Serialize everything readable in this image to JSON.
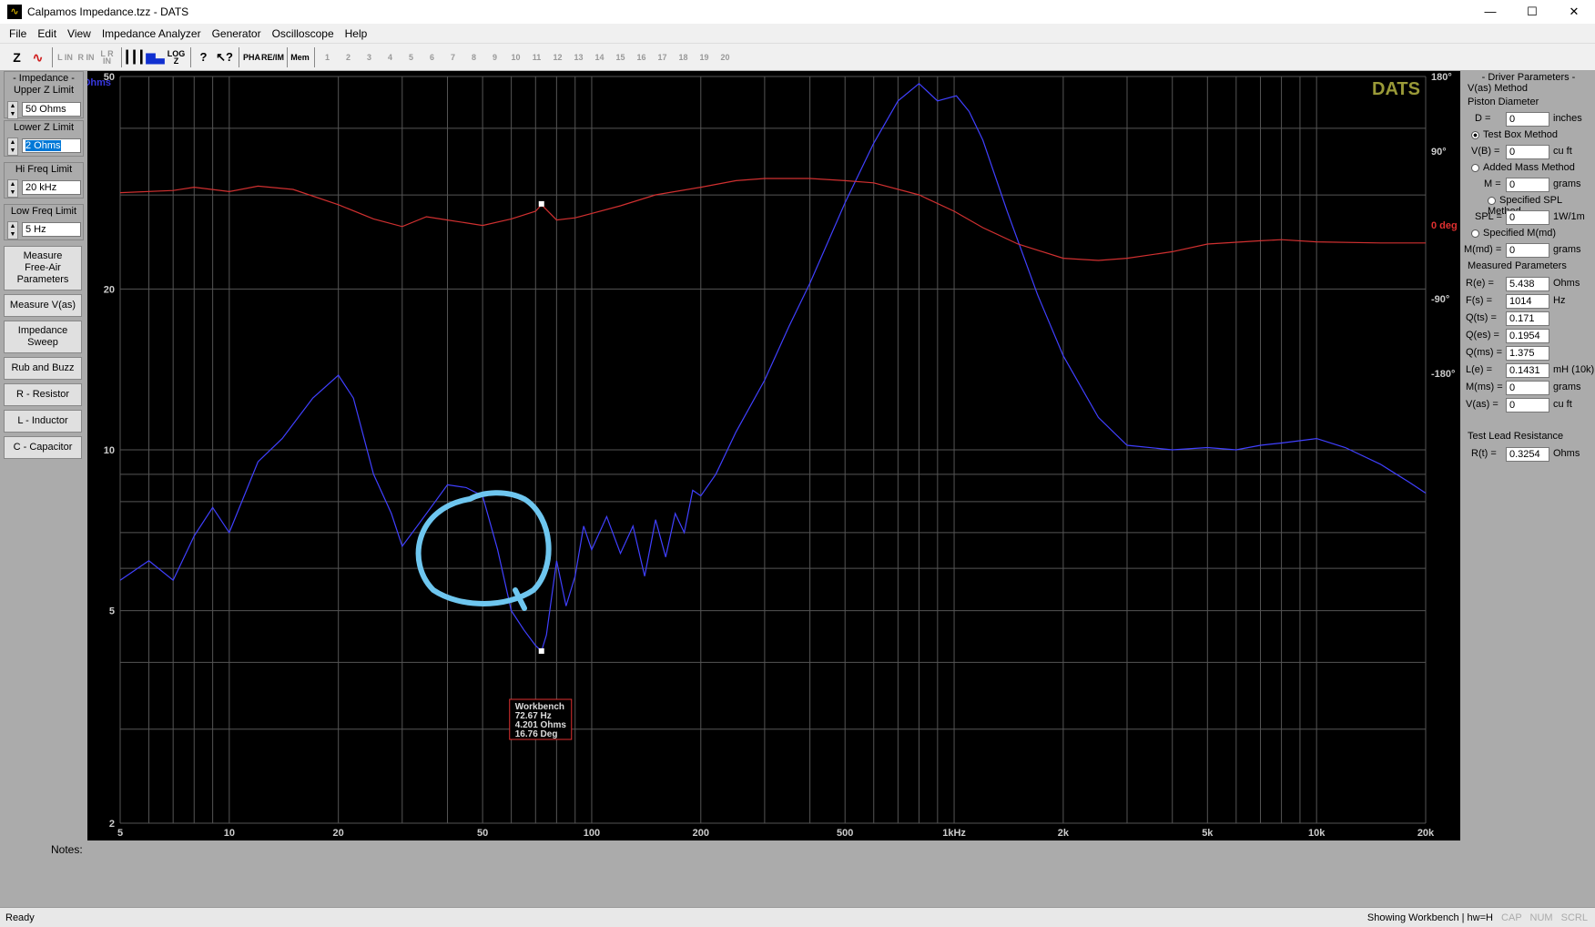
{
  "window": {
    "title": "Calpamos Impedance.tzz - DATS",
    "minimize": "—",
    "maximize": "☐",
    "close": "✕"
  },
  "menu": [
    "File",
    "Edit",
    "View",
    "Impedance Analyzer",
    "Generator",
    "Oscilloscope",
    "Help"
  ],
  "toolbar": {
    "z_label": "Z",
    "pha_label": "PHA",
    "reim_label": "RE/IM",
    "mem_label": "Mem",
    "mem_slots": [
      "1",
      "2",
      "3",
      "4",
      "5",
      "6",
      "7",
      "8",
      "9",
      "10",
      "11",
      "12",
      "13",
      "14",
      "15",
      "16",
      "17",
      "18",
      "19",
      "20"
    ]
  },
  "left_panel": {
    "title": "- Impedance -",
    "upper_z": {
      "label": "Upper Z Limit",
      "value": "50 Ohms"
    },
    "lower_z": {
      "label": "Lower Z Limit",
      "value": "2 Ohms"
    },
    "hi_freq": {
      "label": "Hi Freq Limit",
      "value": "20 kHz"
    },
    "low_freq": {
      "label": "Low Freq Limit",
      "value": "5 Hz"
    },
    "buttons": [
      "Measure Free-Air Parameters",
      "Measure V(as)",
      "Impedance Sweep",
      "Rub and Buzz",
      "R - Resistor",
      "L - Inductor",
      "C - Capacitor"
    ]
  },
  "chart_data": {
    "type": "line",
    "watermark": "DATS",
    "xlabel_ticks": [
      "5",
      "10",
      "20",
      "50",
      "100",
      "200",
      "500",
      "1kHz",
      "2k",
      "5k",
      "10k",
      "20k"
    ],
    "x_ticks_values": [
      5,
      10,
      20,
      50,
      100,
      200,
      500,
      1000,
      2000,
      5000,
      10000,
      20000
    ],
    "xlim": [
      5,
      20000
    ],
    "x_scale": "log",
    "y_left_label": "Ohms",
    "y_left_ticks": [
      "50",
      "20",
      "10",
      "5",
      "2"
    ],
    "y_left_values": [
      50,
      20,
      10,
      5,
      2
    ],
    "ylim_left": [
      2,
      50
    ],
    "y_left_scale": "log",
    "y_right_ticks": [
      "180°",
      "90°",
      "0 deg",
      "-90°",
      "-180°"
    ],
    "y_right_values": [
      180,
      90,
      0,
      -90,
      -180
    ],
    "ylim_right": [
      -180,
      180
    ],
    "series": [
      {
        "name": "Ohms",
        "color": "#4040ff",
        "x": [
          5,
          6,
          7,
          8,
          9,
          10,
          12,
          14,
          17,
          20,
          22,
          25,
          28,
          30,
          33,
          36,
          40,
          45,
          50,
          55,
          60,
          65,
          70,
          72.67,
          75,
          80,
          85,
          90,
          95,
          100,
          110,
          120,
          130,
          140,
          150,
          160,
          170,
          180,
          190,
          200,
          220,
          250,
          300,
          350,
          400,
          500,
          600,
          700,
          800,
          900,
          1014,
          1100,
          1200,
          1400,
          1700,
          2000,
          2500,
          3000,
          4000,
          5000,
          6000,
          7000,
          8000,
          10000,
          12000,
          15000,
          18000,
          20000
        ],
        "y": [
          5.7,
          6.2,
          5.7,
          6.9,
          7.8,
          7.0,
          9.5,
          10.5,
          12.5,
          13.8,
          12.5,
          9.0,
          7.6,
          6.6,
          7.2,
          7.8,
          8.6,
          8.5,
          8.2,
          6.5,
          5.0,
          4.6,
          4.3,
          4.2,
          4.5,
          6.2,
          5.1,
          5.8,
          7.2,
          6.5,
          7.5,
          6.4,
          7.2,
          5.8,
          7.4,
          6.3,
          7.6,
          7.0,
          8.4,
          8.2,
          9.0,
          10.8,
          13.5,
          17.0,
          20.5,
          29.0,
          37.5,
          45.0,
          48.5,
          45.0,
          46.0,
          43.0,
          38.0,
          28.0,
          19.5,
          15.0,
          11.5,
          10.2,
          10.0,
          10.1,
          10.0,
          10.2,
          10.3,
          10.5,
          10.1,
          9.4,
          8.7,
          8.3
        ]
      },
      {
        "name": "Phase",
        "color": "#d03030",
        "x": [
          5,
          7,
          8,
          10,
          12,
          15,
          20,
          25,
          30,
          35,
          40,
          50,
          60,
          70,
          72.67,
          80,
          90,
          100,
          120,
          150,
          200,
          250,
          300,
          400,
          500,
          600,
          800,
          1000,
          1200,
          1500,
          2000,
          2500,
          3000,
          4000,
          5000,
          7000,
          8000,
          10000,
          15000,
          20000
        ],
        "y": [
          27,
          29,
          32,
          28,
          33,
          30,
          16,
          3,
          -4,
          5,
          2,
          -3,
          3,
          10,
          16,
          2,
          4,
          8,
          15,
          25,
          32,
          38,
          40,
          40,
          38,
          36,
          25,
          10,
          -5,
          -20,
          -33,
          -35,
          -33,
          -27,
          -20,
          -17,
          -16,
          -18,
          -19,
          -19
        ]
      }
    ],
    "cursor": {
      "label": "Workbench",
      "freq": "72.67 Hz",
      "ohms": "4.201 Ohms",
      "deg": "16.76 Deg",
      "x": 72.67,
      "y": 4.201
    }
  },
  "right_panel": {
    "title": "- Driver Parameters -",
    "vas_method": "V(as) Method",
    "piston": "Piston Diameter",
    "d": {
      "label": "D =",
      "value": "0",
      "unit": "inches"
    },
    "test_box": "Test Box Method",
    "vb": {
      "label": "V(B) =",
      "value": "0",
      "unit": "cu ft"
    },
    "added_mass": "Added Mass Method",
    "m": {
      "label": "M =",
      "value": "0",
      "unit": "grams"
    },
    "spl_method": "Specified SPL Method",
    "spl": {
      "label": "SPL =",
      "value": "0",
      "unit": "1W/1m"
    },
    "mmd_method": "Specified M(md)",
    "mmd": {
      "label": "M(md) =",
      "value": "0",
      "unit": "grams"
    },
    "measured_title": "Measured Parameters",
    "measured": [
      {
        "label": "R(e) =",
        "value": "5.438",
        "unit": "Ohms"
      },
      {
        "label": "F(s) =",
        "value": "1014",
        "unit": "Hz"
      },
      {
        "label": "Q(ts) =",
        "value": "0.171",
        "unit": ""
      },
      {
        "label": "Q(es) =",
        "value": "0.1954",
        "unit": ""
      },
      {
        "label": "Q(ms) =",
        "value": "1.375",
        "unit": ""
      },
      {
        "label": "L(e) =",
        "value": "0.1431",
        "unit": "mH (10k)"
      },
      {
        "label": "M(ms) =",
        "value": "0",
        "unit": "grams"
      },
      {
        "label": "V(as) =",
        "value": "0",
        "unit": "cu ft"
      }
    ],
    "lead_title": "Test Lead Resistance",
    "rt": {
      "label": "R(t) =",
      "value": "0.3254",
      "unit": "Ohms"
    }
  },
  "notes_label": "Notes:",
  "status": {
    "ready": "Ready",
    "right": "Showing Workbench | hw=H",
    "cap": "CAP",
    "num": "NUM",
    "scrl": "SCRL"
  }
}
